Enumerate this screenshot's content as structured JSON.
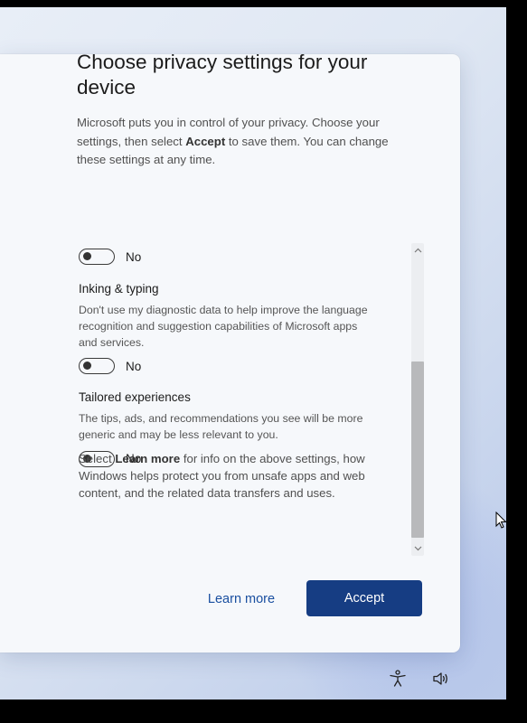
{
  "title": "Choose privacy settings for your device",
  "intro": {
    "part1": "Microsoft puts you in control of your privacy. Choose your settings, then select ",
    "bold": "Accept",
    "part2": " to save them. You can change these settings at any time."
  },
  "settings": [
    {
      "title": "",
      "description": "",
      "toggle_state": "No"
    },
    {
      "title": "Inking & typing",
      "description": "Don't use my diagnostic data to help improve the language recognition and suggestion capabilities of Microsoft apps and services.",
      "toggle_state": "No"
    },
    {
      "title": "Tailored experiences",
      "description": "The tips, ads, and recommendations you see will be more generic and may be less relevant to you.",
      "toggle_state": "No"
    }
  ],
  "footnote": {
    "part1": "Select ",
    "bold": "Learn more",
    "part2": " for info on the above settings, how Windows helps protect you from unsafe apps and web content, and the related data transfers and uses."
  },
  "buttons": {
    "learn_more": "Learn more",
    "accept": "Accept"
  },
  "scrollbar": {
    "up_icon": "chevron-up-icon",
    "down_icon": "chevron-down-icon"
  },
  "tray": {
    "accessibility_icon": "accessibility-icon",
    "volume_icon": "volume-icon"
  },
  "colors": {
    "accent": "#163d83",
    "link": "#1a4fa0"
  }
}
